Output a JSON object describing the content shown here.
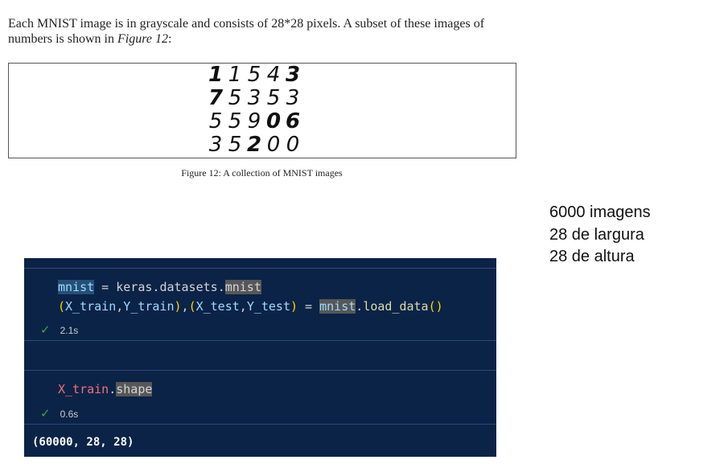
{
  "paper": {
    "intro_part1": "Each MNIST image is in grayscale and consists of 28*28 pixels. A subset of these images of numbers is shown in ",
    "figure_ref": "Figure 12",
    "intro_end": ":",
    "figure_caption": "Figure 12: A collection of MNIST images",
    "digit_rows": [
      [
        "1",
        "1",
        "5",
        "4",
        "3"
      ],
      [
        "7",
        "5",
        "3",
        "5",
        "3"
      ],
      [
        "5",
        "5",
        "9",
        "0",
        "6"
      ],
      [
        "3",
        "5",
        "2",
        "0",
        "0"
      ]
    ]
  },
  "note": {
    "line1": "6000 imagens",
    "line2": "28 de largura",
    "line3": "28 de altura"
  },
  "notebook": {
    "cell1": {
      "line1": {
        "var": "mnist",
        "eq": " = ",
        "mod": "keras",
        "dot1": ".",
        "attr1": "datasets",
        "dot2": ".",
        "attr2": "mnist"
      },
      "line2": {
        "open_outer": "(",
        "open1": "(",
        "a": "X_train",
        "c1": ",",
        "b": "Y_train",
        "close1": ")",
        "c2": ",",
        "open2": "(",
        "c": "X_test",
        "c3": ",",
        "d": "Y_test",
        "close2": ")",
        "close_outer": "",
        "eq": " = ",
        "var": "mnist",
        "dot": ".",
        "fn": "load_data",
        "call": "()"
      },
      "exec_time": "2.1s"
    },
    "cell2": {
      "var": "X_train",
      "dot": ".",
      "attr": "shape",
      "exec_time": "0.6s",
      "output": "(60000, 28, 28)"
    },
    "check_icon": "✓"
  }
}
